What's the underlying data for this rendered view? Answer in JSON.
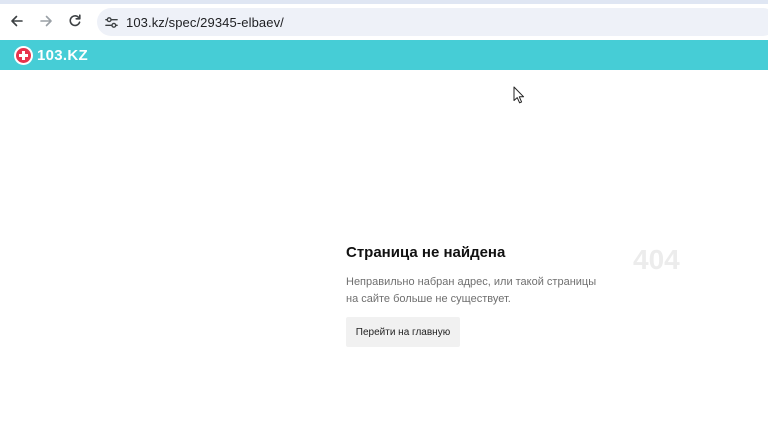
{
  "browser": {
    "url": "103.kz/spec/29345-elbaev/",
    "back_icon": "back-arrow-icon",
    "forward_icon": "forward-arrow-icon",
    "reload_icon": "reload-icon",
    "site_info_icon": "site-settings-icon"
  },
  "site": {
    "logo_text": "103.KZ",
    "logo_icon": "plus-cross-icon",
    "header_color": "#46cdd6",
    "logo_accent": "#e8334c"
  },
  "error_page": {
    "title": "Страница не найдена",
    "code": "404",
    "description": "Неправильно набран адрес, или такой страницы на сайте больше не существует.",
    "home_button_label": "Перейти на главную"
  }
}
